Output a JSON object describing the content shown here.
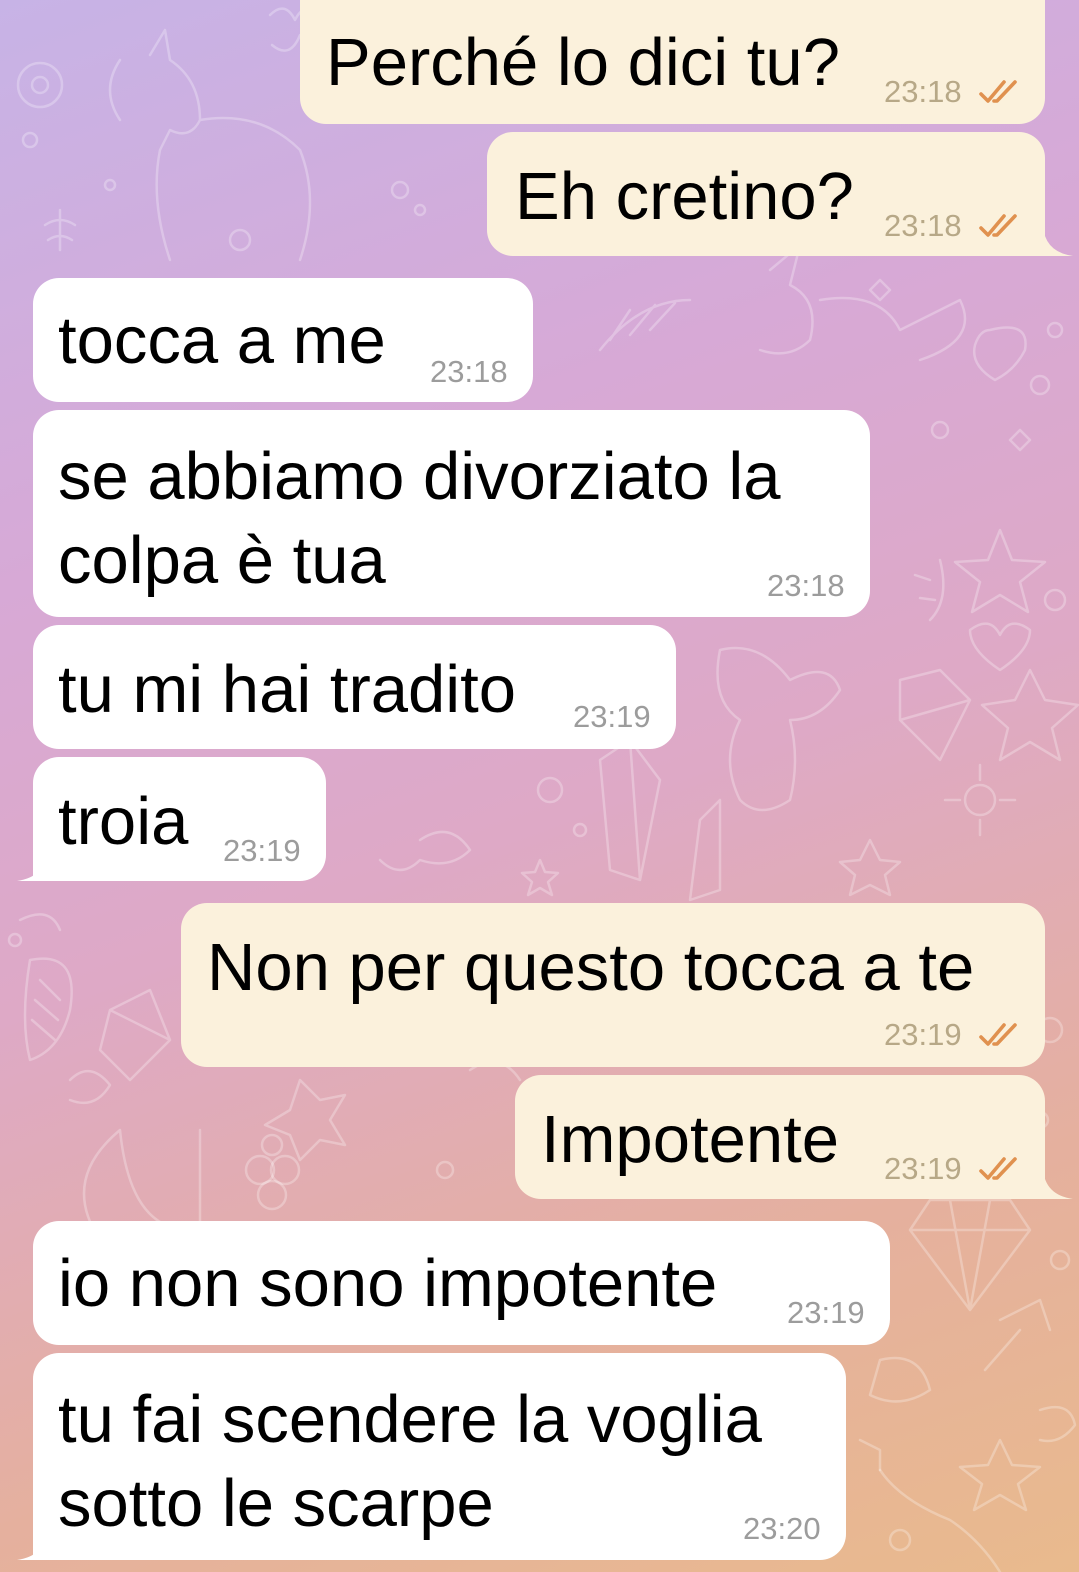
{
  "messages": [
    {
      "id": "m1",
      "direction": "outgoing",
      "text": "Perché lo dici tu?",
      "time": "23:18",
      "status": "read-double-check"
    },
    {
      "id": "m2",
      "direction": "outgoing",
      "text": "Eh cretino?",
      "time": "23:18",
      "status": "read-double-check"
    },
    {
      "id": "m3",
      "direction": "incoming",
      "text": "tocca a me",
      "time": "23:18"
    },
    {
      "id": "m4",
      "direction": "incoming",
      "text_lines": [
        "se abbiamo divorziato la",
        "colpa è tua"
      ],
      "time": "23:18"
    },
    {
      "id": "m5",
      "direction": "incoming",
      "text": "tu mi hai tradito",
      "time": "23:19"
    },
    {
      "id": "m6",
      "direction": "incoming",
      "text": "troia",
      "time": "23:19"
    },
    {
      "id": "m7",
      "direction": "outgoing",
      "text": "Non per questo tocca a te",
      "time": "23:19",
      "status": "read-double-check"
    },
    {
      "id": "m8",
      "direction": "outgoing",
      "text": "Impotente",
      "time": "23:19",
      "status": "read-double-check"
    },
    {
      "id": "m9",
      "direction": "incoming",
      "text": "io non sono impotente",
      "time": "23:19"
    },
    {
      "id": "m10",
      "direction": "incoming",
      "text_lines": [
        "tu fai scendere la voglia",
        "sotto le scarpe"
      ],
      "time": "23:20"
    }
  ],
  "colors": {
    "incoming_bubble": "#ffffff",
    "outgoing_bubble": "#fbf1dc",
    "timestamp": "#9c9c9c",
    "read_check": "#e0914f"
  },
  "icons": {
    "status": "double-check-icon",
    "background": "unicorn-doodle-wallpaper"
  }
}
